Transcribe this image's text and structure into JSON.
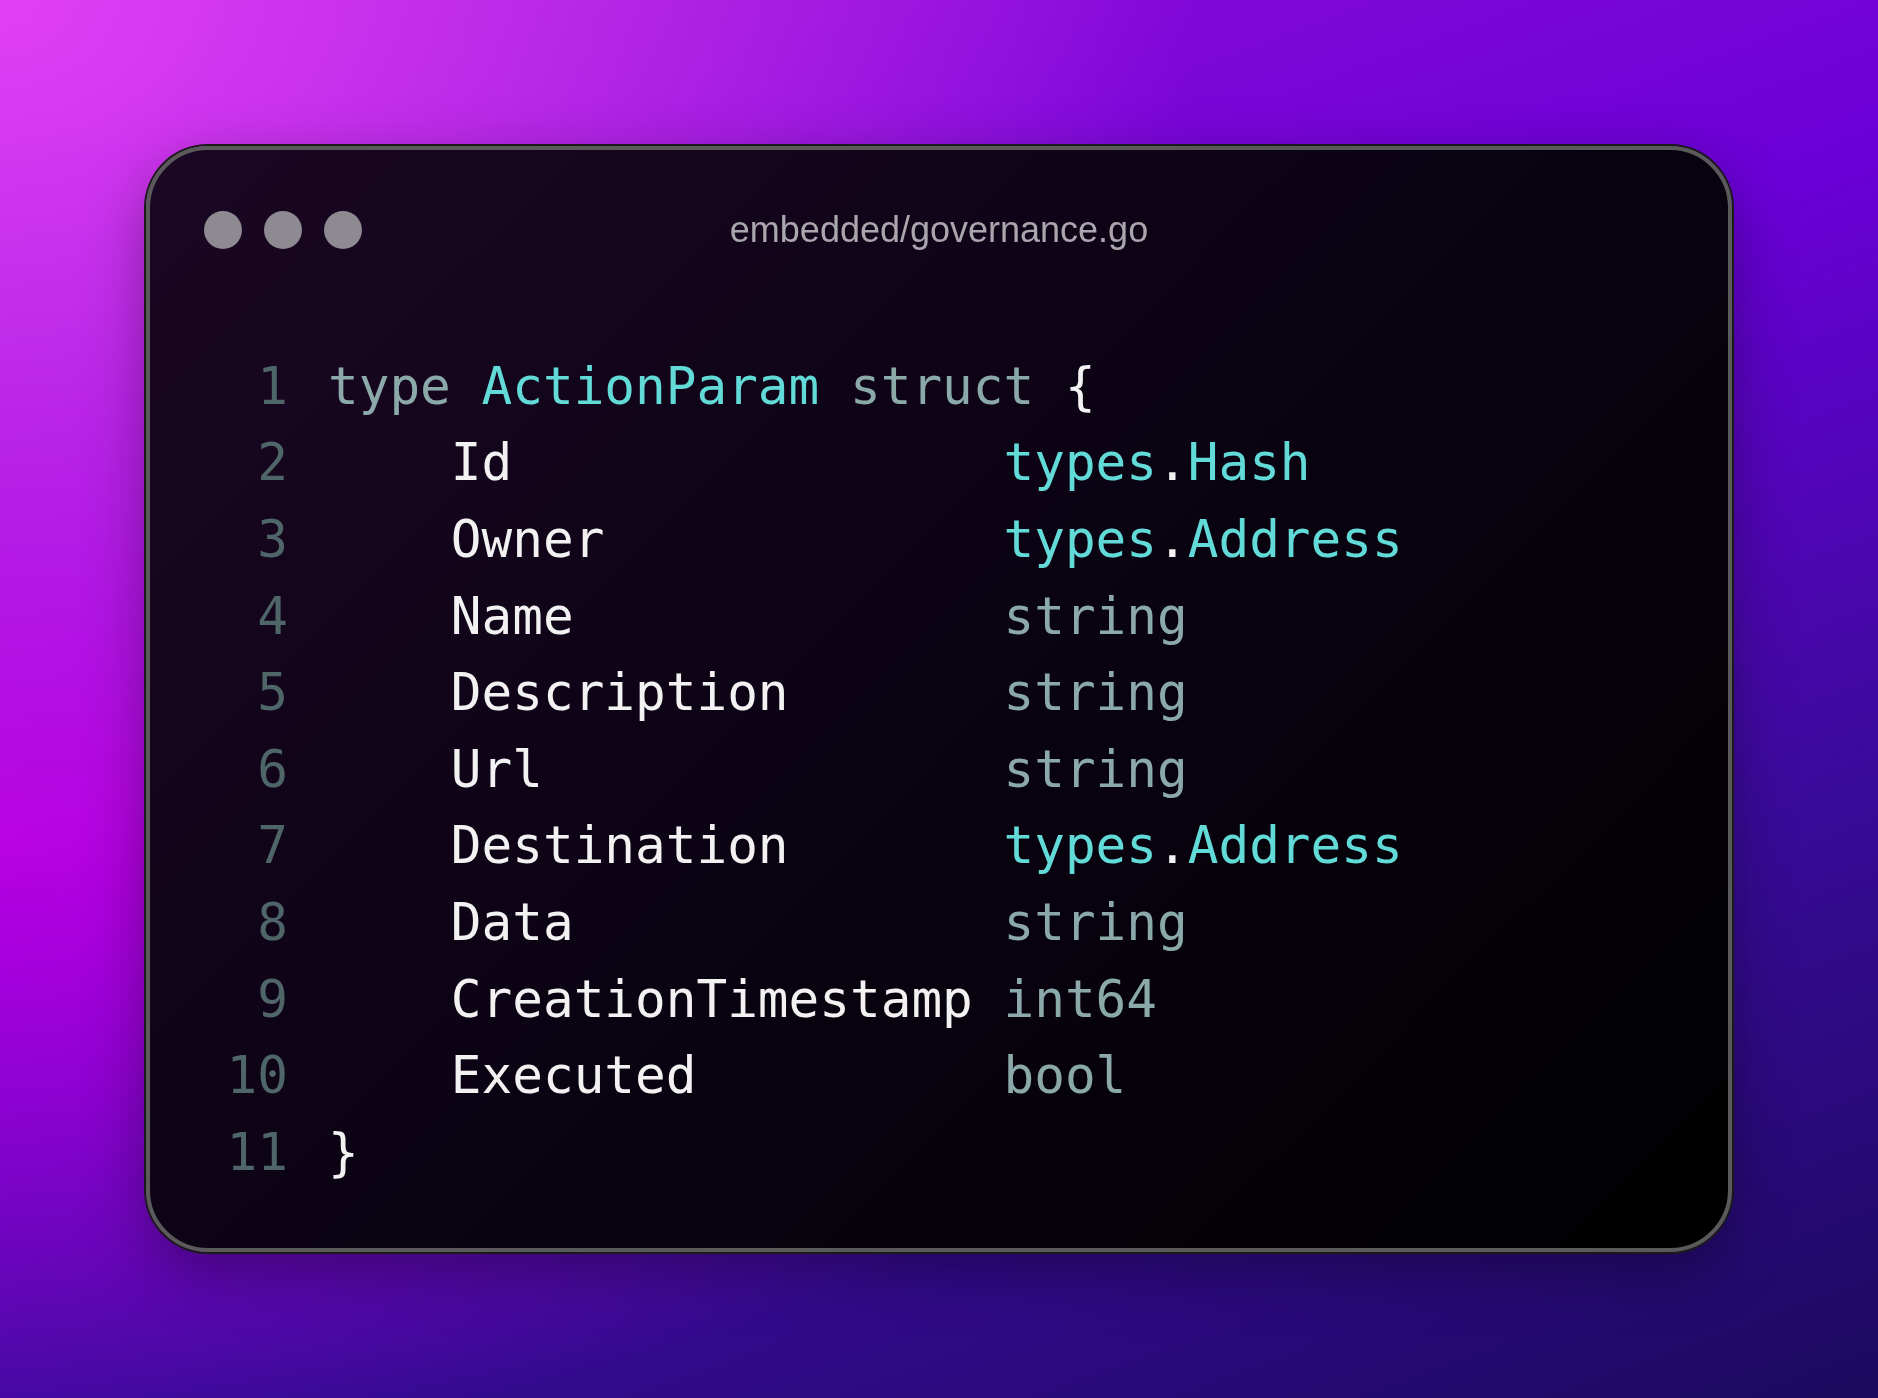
{
  "window": {
    "title": "embedded/governance.go"
  },
  "lines": [
    {
      "number": "1",
      "kind": "code",
      "tokens": [
        {
          "text": "type",
          "kind": "keyword"
        },
        {
          "text": "ActionParam",
          "kind": "type-name"
        },
        {
          "text": "struct",
          "kind": "keyword"
        },
        {
          "text": "{",
          "kind": "punct"
        }
      ]
    },
    {
      "number": "2",
      "kind": "field",
      "field": "Id",
      "type": [
        {
          "text": "types",
          "kind": "package"
        },
        {
          "text": ".",
          "kind": "punct"
        },
        {
          "text": "Hash",
          "kind": "type-name"
        }
      ]
    },
    {
      "number": "3",
      "kind": "field",
      "field": "Owner",
      "type": [
        {
          "text": "types",
          "kind": "package"
        },
        {
          "text": ".",
          "kind": "punct"
        },
        {
          "text": "Address",
          "kind": "type-name"
        }
      ]
    },
    {
      "number": "4",
      "kind": "field",
      "field": "Name",
      "type": [
        {
          "text": "string",
          "kind": "builtin"
        }
      ]
    },
    {
      "number": "5",
      "kind": "field",
      "field": "Description",
      "type": [
        {
          "text": "string",
          "kind": "builtin"
        }
      ]
    },
    {
      "number": "6",
      "kind": "field",
      "field": "Url",
      "type": [
        {
          "text": "string",
          "kind": "builtin"
        }
      ]
    },
    {
      "number": "7",
      "kind": "field",
      "field": "Destination",
      "type": [
        {
          "text": "types",
          "kind": "package"
        },
        {
          "text": ".",
          "kind": "punct"
        },
        {
          "text": "Address",
          "kind": "type-name"
        }
      ]
    },
    {
      "number": "8",
      "kind": "field",
      "field": "Data",
      "type": [
        {
          "text": "string",
          "kind": "builtin"
        }
      ]
    },
    {
      "number": "9",
      "kind": "field",
      "field": "CreationTimestamp",
      "type": [
        {
          "text": "int64",
          "kind": "builtin"
        }
      ]
    },
    {
      "number": "10",
      "kind": "field",
      "field": "Executed",
      "type": [
        {
          "text": "bool",
          "kind": "builtin"
        }
      ]
    },
    {
      "number": "11",
      "kind": "code",
      "tokens": [
        {
          "text": "}",
          "kind": "punct"
        }
      ]
    }
  ]
}
